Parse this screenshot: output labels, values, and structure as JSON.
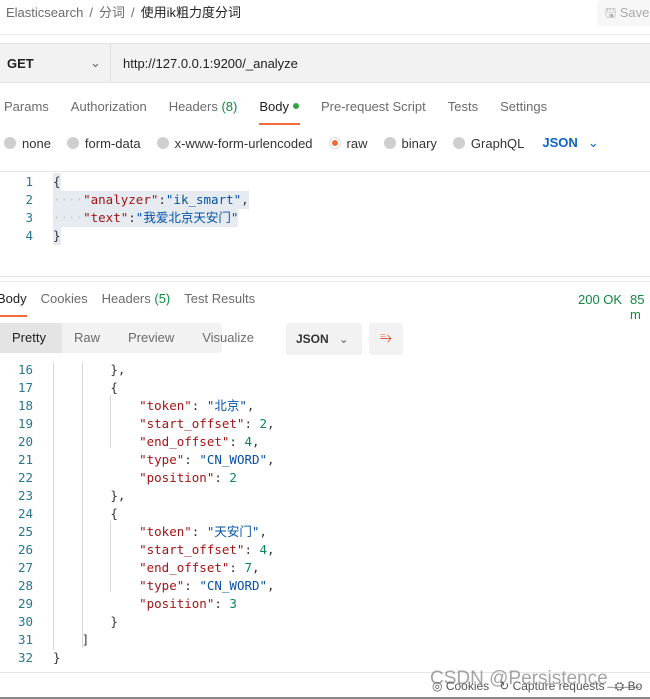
{
  "breadcrumb": [
    "Elasticsearch",
    "分词",
    "使用ik粗力度分词"
  ],
  "save_label": "Save",
  "request": {
    "method": "GET",
    "url": "http://127.0.0.1:9200/_analyze"
  },
  "request_tabs": [
    {
      "label": "Params"
    },
    {
      "label": "Authorization"
    },
    {
      "label": "Headers",
      "count": "(8)"
    },
    {
      "label": "Body",
      "active": true
    },
    {
      "label": "Pre-request Script"
    },
    {
      "label": "Tests"
    },
    {
      "label": "Settings"
    }
  ],
  "body_types": [
    {
      "label": "none"
    },
    {
      "label": "form-data"
    },
    {
      "label": "x-www-form-urlencoded"
    },
    {
      "label": "raw",
      "selected": true
    },
    {
      "label": "binary"
    },
    {
      "label": "GraphQL"
    }
  ],
  "body_format": "JSON",
  "request_body": [
    {
      "n": "1",
      "t": [
        [
          "p",
          "{"
        ]
      ]
    },
    {
      "n": "2",
      "t": [
        [
          "ws",
          "····"
        ],
        [
          "k",
          "\"analyzer\""
        ],
        [
          "p",
          ":"
        ],
        [
          "s",
          "\"ik_smart\""
        ],
        [
          "p",
          ","
        ]
      ]
    },
    {
      "n": "3",
      "t": [
        [
          "ws",
          "····"
        ],
        [
          "k",
          "\"text\""
        ],
        [
          "p",
          ":"
        ],
        [
          "s",
          "\"我爱北京天安门\""
        ]
      ]
    },
    {
      "n": "4",
      "t": [
        [
          "p",
          "}"
        ]
      ]
    }
  ],
  "response_tabs": [
    {
      "label": "Body",
      "active": true
    },
    {
      "label": "Cookies"
    },
    {
      "label": "Headers",
      "count": "(5)"
    },
    {
      "label": "Test Results"
    }
  ],
  "status": "200 OK",
  "time": "85 m",
  "views": [
    "Pretty",
    "Raw",
    "Preview",
    "Visualize"
  ],
  "response_format": "JSON",
  "response_body": [
    {
      "n": "16",
      "lv": 2,
      "t": [
        [
          "p",
          "},"
        ]
      ]
    },
    {
      "n": "17",
      "lv": 2,
      "t": [
        [
          "p",
          "{"
        ]
      ]
    },
    {
      "n": "18",
      "lv": 3,
      "t": [
        [
          "k",
          "\"token\""
        ],
        [
          "p",
          ": "
        ],
        [
          "s",
          "\"北京\""
        ],
        [
          "p",
          ","
        ]
      ]
    },
    {
      "n": "19",
      "lv": 3,
      "t": [
        [
          "k",
          "\"start_offset\""
        ],
        [
          "p",
          ": "
        ],
        [
          "n",
          "2"
        ],
        [
          "p",
          ","
        ]
      ]
    },
    {
      "n": "20",
      "lv": 3,
      "t": [
        [
          "k",
          "\"end_offset\""
        ],
        [
          "p",
          ": "
        ],
        [
          "n",
          "4"
        ],
        [
          "p",
          ","
        ]
      ]
    },
    {
      "n": "21",
      "lv": 3,
      "t": [
        [
          "k",
          "\"type\""
        ],
        [
          "p",
          ": "
        ],
        [
          "s",
          "\"CN_WORD\""
        ],
        [
          "p",
          ","
        ]
      ]
    },
    {
      "n": "22",
      "lv": 3,
      "t": [
        [
          "k",
          "\"position\""
        ],
        [
          "p",
          ": "
        ],
        [
          "n",
          "2"
        ]
      ]
    },
    {
      "n": "23",
      "lv": 2,
      "t": [
        [
          "p",
          "},"
        ]
      ]
    },
    {
      "n": "24",
      "lv": 2,
      "t": [
        [
          "p",
          "{"
        ]
      ]
    },
    {
      "n": "25",
      "lv": 3,
      "t": [
        [
          "k",
          "\"token\""
        ],
        [
          "p",
          ": "
        ],
        [
          "s",
          "\"天安门\""
        ],
        [
          "p",
          ","
        ]
      ]
    },
    {
      "n": "26",
      "lv": 3,
      "t": [
        [
          "k",
          "\"start_offset\""
        ],
        [
          "p",
          ": "
        ],
        [
          "n",
          "4"
        ],
        [
          "p",
          ","
        ]
      ]
    },
    {
      "n": "27",
      "lv": 3,
      "t": [
        [
          "k",
          "\"end_offset\""
        ],
        [
          "p",
          ": "
        ],
        [
          "n",
          "7"
        ],
        [
          "p",
          ","
        ]
      ]
    },
    {
      "n": "28",
      "lv": 3,
      "t": [
        [
          "k",
          "\"type\""
        ],
        [
          "p",
          ": "
        ],
        [
          "s",
          "\"CN_WORD\""
        ],
        [
          "p",
          ","
        ]
      ]
    },
    {
      "n": "29",
      "lv": 3,
      "t": [
        [
          "k",
          "\"position\""
        ],
        [
          "p",
          ": "
        ],
        [
          "n",
          "3"
        ]
      ]
    },
    {
      "n": "30",
      "lv": 2,
      "t": [
        [
          "p",
          "}"
        ]
      ]
    },
    {
      "n": "31",
      "lv": 1,
      "t": [
        [
          "p",
          "]"
        ]
      ]
    },
    {
      "n": "32",
      "lv": 0,
      "t": [
        [
          "p",
          "}"
        ]
      ]
    }
  ],
  "footer": {
    "cookies": "Cookies",
    "capture": "Capture requests",
    "bootcamp": "Bo"
  },
  "watermark": "CSDN @Persistence___",
  "colors": {
    "accent": "#f26b3a",
    "status": "#0f8a3f",
    "json_key": "#a31515",
    "json_string": "#0451a5",
    "json_number": "#098658"
  }
}
